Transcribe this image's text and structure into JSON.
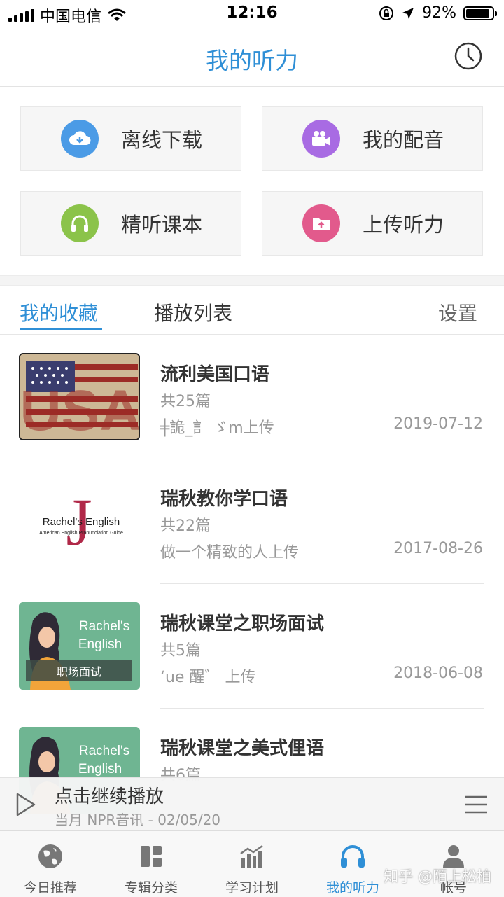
{
  "status": {
    "carrier": "中国电信",
    "time": "12:16",
    "battery_pct": "92%",
    "battery_level": 0.92
  },
  "nav": {
    "title": "我的听力",
    "history_icon": "clock-icon"
  },
  "grid": [
    {
      "label": "离线下载",
      "icon": "download-cloud-icon",
      "color": "#4b9be6"
    },
    {
      "label": "我的配音",
      "icon": "video-camera-icon",
      "color": "#a86be3"
    },
    {
      "label": "精听课本",
      "icon": "headphones-icon",
      "color": "#8bc34a"
    },
    {
      "label": "上传听力",
      "icon": "upload-folder-icon",
      "color": "#e25a8c"
    }
  ],
  "tabs": {
    "favorites": "我的收藏",
    "playlist": "播放列表",
    "settings": "设置"
  },
  "list": [
    {
      "title": "流利美国口语",
      "count": "共25篇",
      "uploader": "╪詭_訁 ゞm上传",
      "date": "2019-07-12",
      "thumb": "USA"
    },
    {
      "title": "瑞秋教你学口语",
      "count": "共22篇",
      "uploader": "做一个精致的人上传",
      "date": "2017-08-26",
      "thumb_text": "Rachel's English",
      "thumb_sub": "American English Pronunciation Guide"
    },
    {
      "title": "瑞秋课堂之职场面试",
      "count": "共5篇",
      "uploader": "ʻue 醒゛ 上传",
      "date": "2018-06-08",
      "thumb_text1": "Rachel's",
      "thumb_text2": "English",
      "thumb_badge": "职场面试"
    },
    {
      "title": "瑞秋课堂之美式俚语",
      "count": "共6篇",
      "thumb_text1": "Rachel's",
      "thumb_text2": "English"
    }
  ],
  "player": {
    "title": "点击继续播放",
    "subtitle": "当月 NPR音讯 - 02/05/20"
  },
  "tabbar": [
    {
      "label": "今日推荐",
      "icon": "globe-icon"
    },
    {
      "label": "专辑分类",
      "icon": "category-icon"
    },
    {
      "label": "学习计划",
      "icon": "chart-icon"
    },
    {
      "label": "我的听力",
      "icon": "headphones-icon",
      "active": true
    },
    {
      "label": "帐号",
      "icon": "user-icon"
    }
  ],
  "watermark": "知乎 @陌上松柏"
}
